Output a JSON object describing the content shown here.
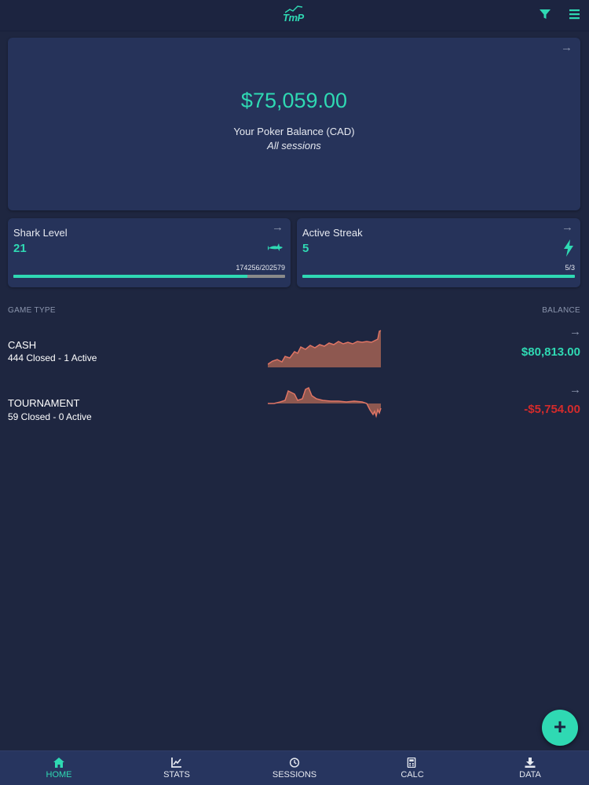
{
  "app": {
    "logo_text": "TmP"
  },
  "header": {
    "filter_icon": "filter-icon",
    "menu_icon": "hamburger-menu-icon"
  },
  "balance": {
    "amount": "$75,059.00",
    "label": "Your Poker Balance (CAD)",
    "subtitle": "All sessions"
  },
  "shark_level": {
    "title": "Shark Level",
    "value": "21",
    "progress_text": "174256/202579",
    "progress": 0.86,
    "icon": "shark-icon"
  },
  "active_streak": {
    "title": "Active Streak",
    "value": "5",
    "progress_text": "5/3",
    "progress": 1.0,
    "icon": "lightning-icon"
  },
  "game_list": {
    "header_left": "GAME TYPE",
    "header_right": "BALANCE",
    "games": [
      {
        "name": "CASH",
        "summary": "444 Closed - 1 Active",
        "balance": "$80,813.00",
        "balance_color": "#2fd9b3"
      },
      {
        "name": "TOURNAMENT",
        "summary": "59 Closed - 0 Active",
        "balance": "-$5,754.00",
        "balance_color": "#d42b2b"
      }
    ]
  },
  "colors": {
    "accent": "#2fd9b3",
    "negative": "#d42b2b",
    "spark": "#e07565"
  },
  "bottom_nav": [
    {
      "label": "HOME",
      "icon": "home-icon",
      "active": true
    },
    {
      "label": "STATS",
      "icon": "chart-icon",
      "active": false
    },
    {
      "label": "SESSIONS",
      "icon": "clock-icon",
      "active": false
    },
    {
      "label": "CALC",
      "icon": "calculator-icon",
      "active": false
    },
    {
      "label": "DATA",
      "icon": "download-icon",
      "active": false
    }
  ]
}
